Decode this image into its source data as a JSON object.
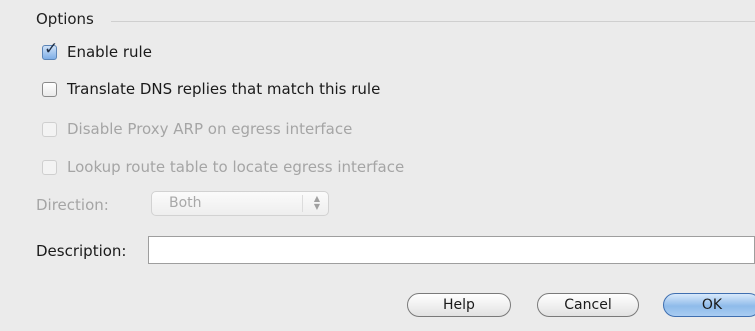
{
  "options": {
    "title": "Options",
    "items": [
      {
        "label": "Enable rule",
        "checked": true,
        "enabled": true
      },
      {
        "label": "Translate DNS replies that match this rule",
        "checked": false,
        "enabled": true
      },
      {
        "label": "Disable Proxy ARP on egress interface",
        "checked": false,
        "enabled": false
      },
      {
        "label": "Lookup route table to locate egress interface",
        "checked": false,
        "enabled": false
      }
    ]
  },
  "direction": {
    "label": "Direction:",
    "value": "Both",
    "enabled": false
  },
  "description": {
    "label": "Description:",
    "value": ""
  },
  "buttons": {
    "help": "Help",
    "cancel": "Cancel",
    "ok": "OK"
  }
}
